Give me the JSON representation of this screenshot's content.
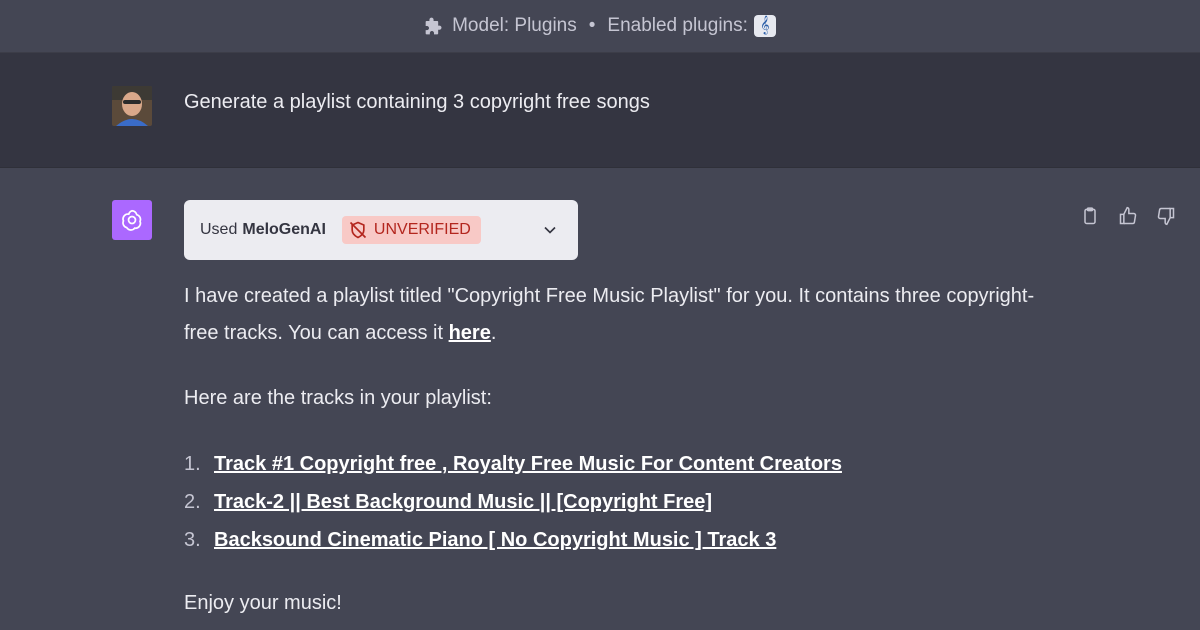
{
  "topbar": {
    "model_label": "Model: Plugins",
    "separator": "•",
    "enabled_label": "Enabled plugins:",
    "plugin_icon": "treble-clef-icon"
  },
  "user_message": {
    "text": "Generate a playlist containing 3 copyright free songs"
  },
  "assistant": {
    "plugin_used_prefix": "Used",
    "plugin_name": "MeloGenAI",
    "plugin_status": "UNVERIFIED",
    "paragraph1_text": "I have created a playlist titled \"Copyright Free Music Playlist\" for you. It contains three copyright-free tracks. You can access it ",
    "paragraph1_link": "here",
    "paragraph1_end": ".",
    "paragraph2": "Here are the tracks in your playlist:",
    "tracks": [
      {
        "num": "1.",
        "title": "Track #1 Copyright free , Royalty Free Music For Content Creators"
      },
      {
        "num": "2.",
        "title": "Track-2 || Best Background Music || [Copyright Free]"
      },
      {
        "num": "3.",
        "title": "Backsound Cinematic Piano [ No Copyright Music ] Track 3"
      }
    ],
    "closing": "Enjoy your music!"
  },
  "colors": {
    "background": "#444654",
    "user_row": "#343541",
    "gpt_avatar": "#ab68ff",
    "unverified_bg": "#f8c9c6",
    "unverified_text": "#b3261e"
  }
}
